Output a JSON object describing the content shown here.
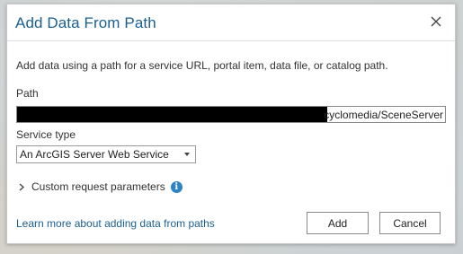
{
  "dialog": {
    "title": "Add Data From Path",
    "close_icon": "close-icon",
    "description": "Add data using a path for a service URL, portal item, data file, or catalog path."
  },
  "path": {
    "label": "Path",
    "value": "cyclomedia/SceneServer",
    "redacted": true
  },
  "service_type": {
    "label": "Service type",
    "selected": "An ArcGIS Server Web Service"
  },
  "custom_params": {
    "label": "Custom request parameters",
    "expander_icon": "chevron-right-icon",
    "info_icon": "info-icon"
  },
  "footer": {
    "learn_more": "Learn more about adding data from paths",
    "add_label": "Add",
    "cancel_label": "Cancel"
  },
  "colors": {
    "title": "#1a5f8f",
    "link": "#1a5f8f",
    "info": "#2c84c6"
  }
}
